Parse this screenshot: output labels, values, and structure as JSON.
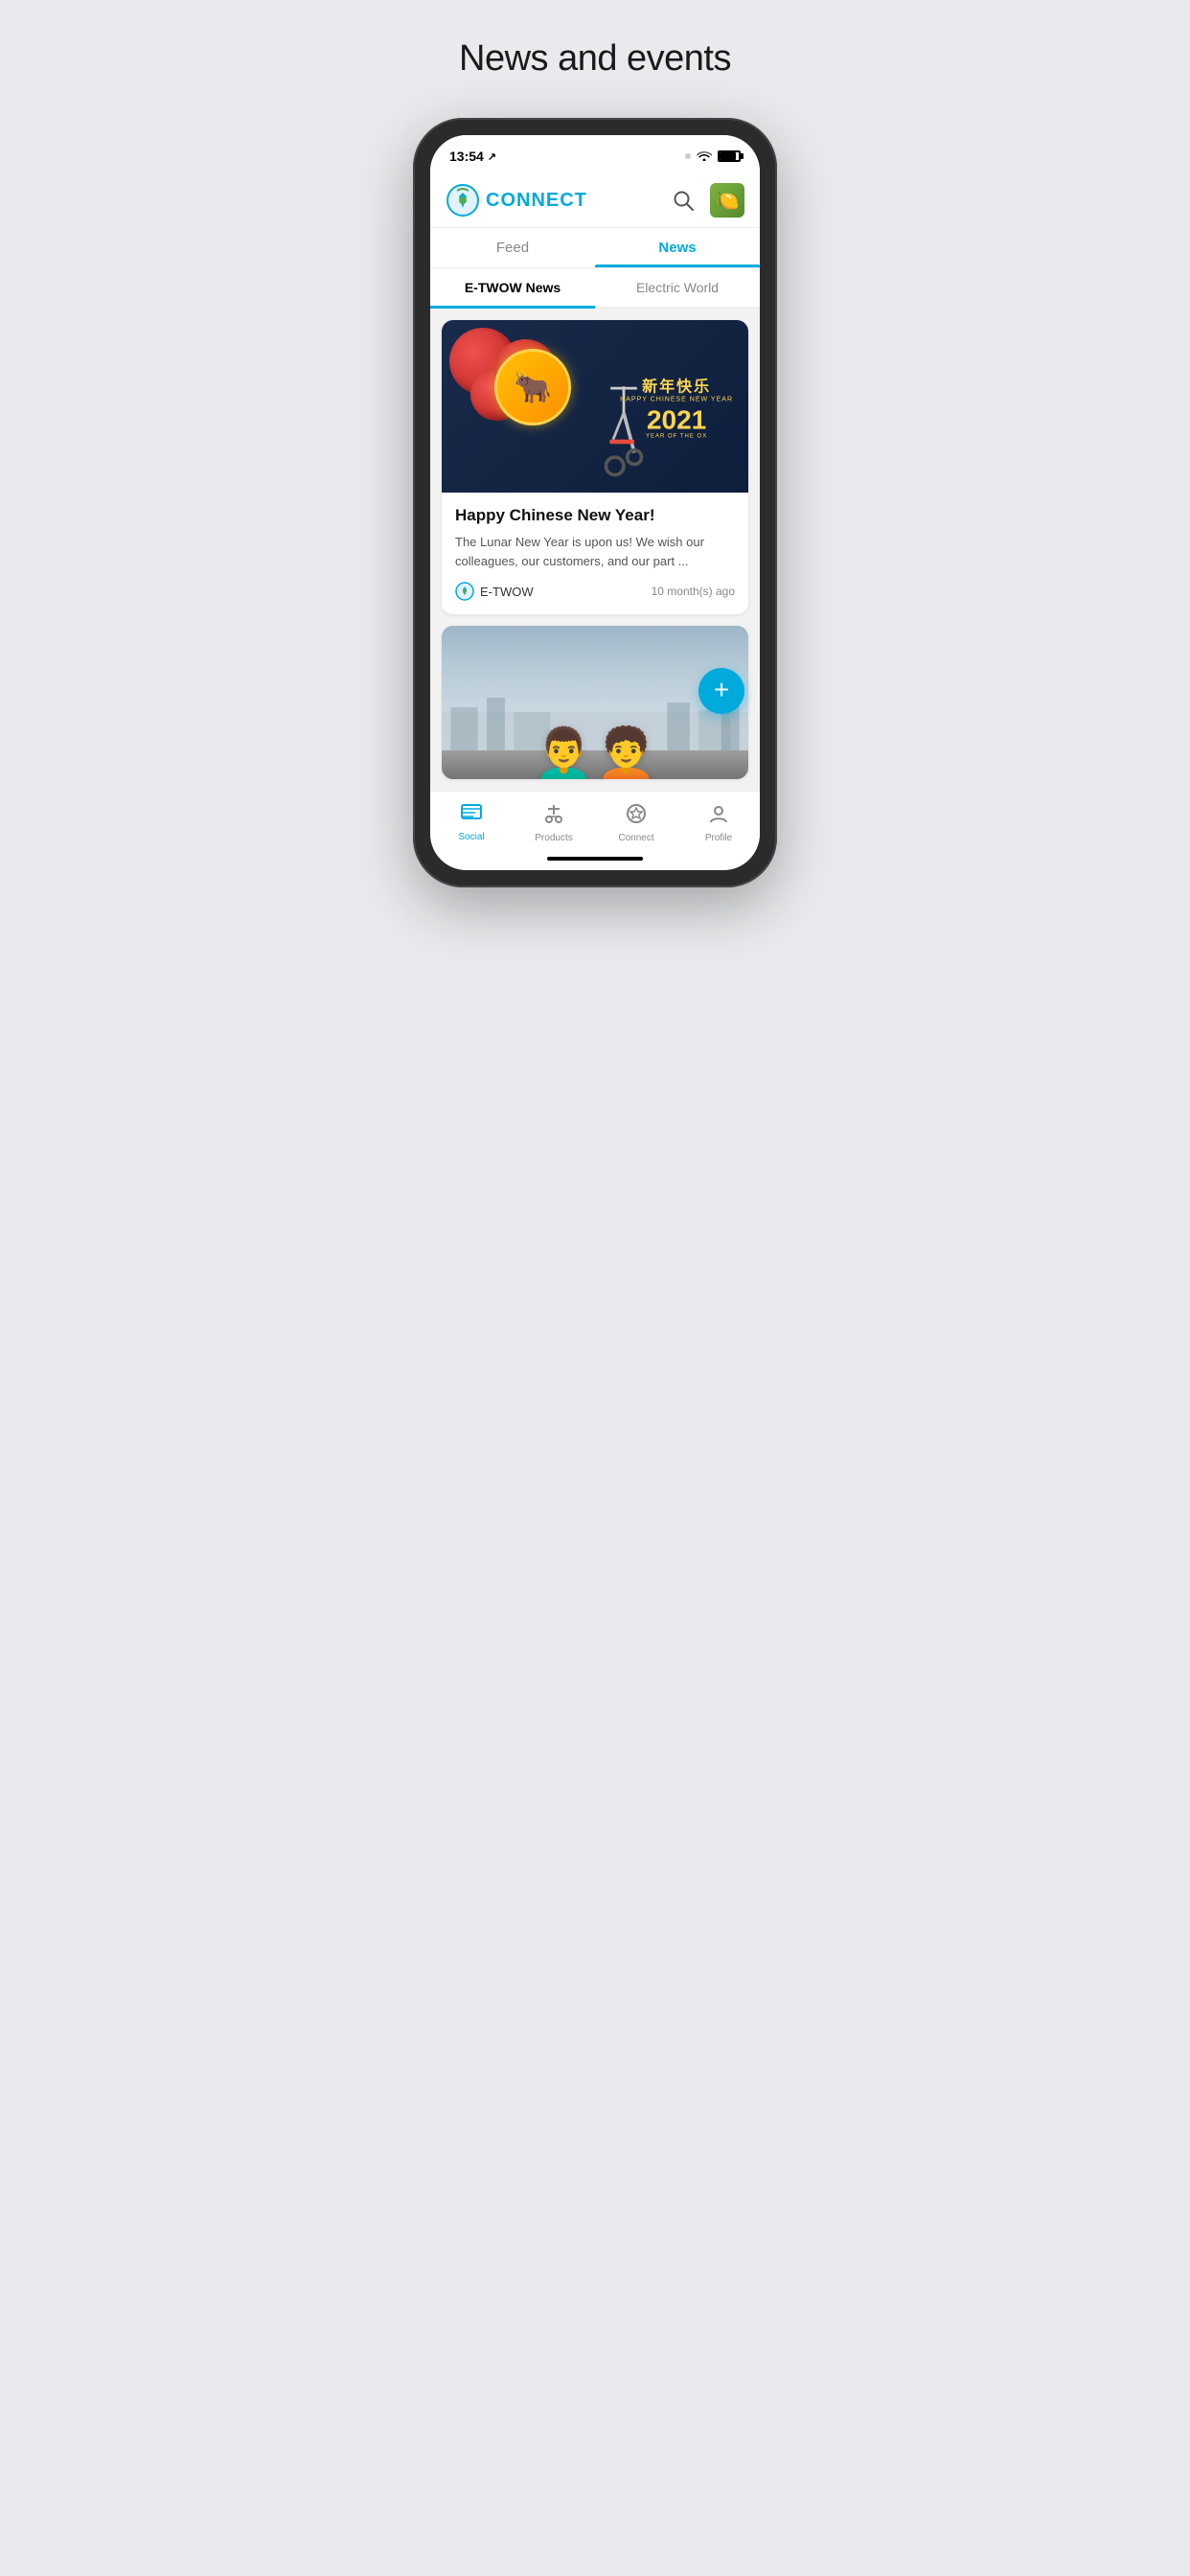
{
  "page": {
    "title": "News and events"
  },
  "status_bar": {
    "time": "13:54",
    "navigation_icon": "↗"
  },
  "header": {
    "logo_text": "CONNECT",
    "search_label": "search",
    "avatar_emoji": "🍋"
  },
  "tabs_main": [
    {
      "id": "feed",
      "label": "Feed",
      "active": false
    },
    {
      "id": "news",
      "label": "News",
      "active": true
    }
  ],
  "tabs_sub": [
    {
      "id": "etwow-news",
      "label": "E-TWOW News",
      "active": true
    },
    {
      "id": "electric-world",
      "label": "Electric World",
      "active": false
    }
  ],
  "news_cards": [
    {
      "id": "chinese-new-year",
      "banner_chinese": "新年快乐",
      "banner_english": "Happy Chinese New Year",
      "banner_year": "2021",
      "banner_year_of": "Year of the Ox",
      "banner_emoji": "🐂",
      "title": "Happy Chinese New Year!",
      "excerpt": "The Lunar New Year is upon us! We wish our colleagues, our customers, and our part ...",
      "source": "E-TWOW",
      "time": "10 month(s) ago"
    },
    {
      "id": "couple-scooter",
      "couple_emoji": "👫🛴",
      "title": "",
      "excerpt": "",
      "source": "",
      "time": ""
    }
  ],
  "fab": {
    "label": "+"
  },
  "bottom_nav": [
    {
      "id": "social",
      "icon": "📰",
      "label": "Social",
      "active": true
    },
    {
      "id": "products",
      "icon": "🛴",
      "label": "Products",
      "active": false
    },
    {
      "id": "connect",
      "icon": "✳",
      "label": "Connect",
      "active": false
    },
    {
      "id": "profile",
      "icon": "👤",
      "label": "Profile",
      "active": false
    }
  ]
}
